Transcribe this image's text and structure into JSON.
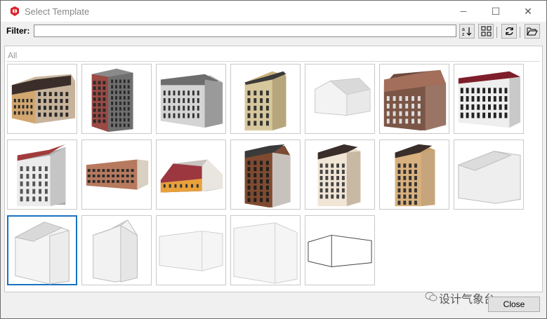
{
  "window": {
    "title": "Select Template"
  },
  "titlebar": {
    "minimize": "─",
    "maximize": "☐",
    "close": "✕"
  },
  "toolbar": {
    "filter_label": "Filter:",
    "filter_value": "",
    "sort_icon": "sort-az-icon",
    "grid_icon": "grid-view-icon",
    "refresh_icon": "refresh-icon",
    "open_icon": "open-folder-icon"
  },
  "category": {
    "label": "All"
  },
  "templates": [
    {
      "style": "row-townhouse-brick"
    },
    {
      "style": "grey-brick-tower"
    },
    {
      "style": "grey-classic-block"
    },
    {
      "style": "beige-tall-gable"
    },
    {
      "style": "blank-wide-gable"
    },
    {
      "style": "brown-classic-block"
    },
    {
      "style": "ornate-classic-block"
    },
    {
      "style": "white-red-roof"
    },
    {
      "style": "long-balcony-block"
    },
    {
      "style": "yellow-cottage"
    },
    {
      "style": "brown-tall-tower"
    },
    {
      "style": "ornate-arcade-tower"
    },
    {
      "style": "beige-ornate-tower"
    },
    {
      "style": "blank-gable-large"
    },
    {
      "style": "blank-gable-selected"
    },
    {
      "style": "blank-gable-narrow"
    },
    {
      "style": "blank-box-wide"
    },
    {
      "style": "blank-box-tall"
    },
    {
      "style": "blank-box-outline"
    }
  ],
  "selected_index": 14,
  "footer": {
    "close_label": "Close",
    "watermark": "设计气象台"
  },
  "colors": {
    "accent": "#1971c2",
    "window_bg": "#f0f0f0",
    "app_red": "#d6262b"
  }
}
